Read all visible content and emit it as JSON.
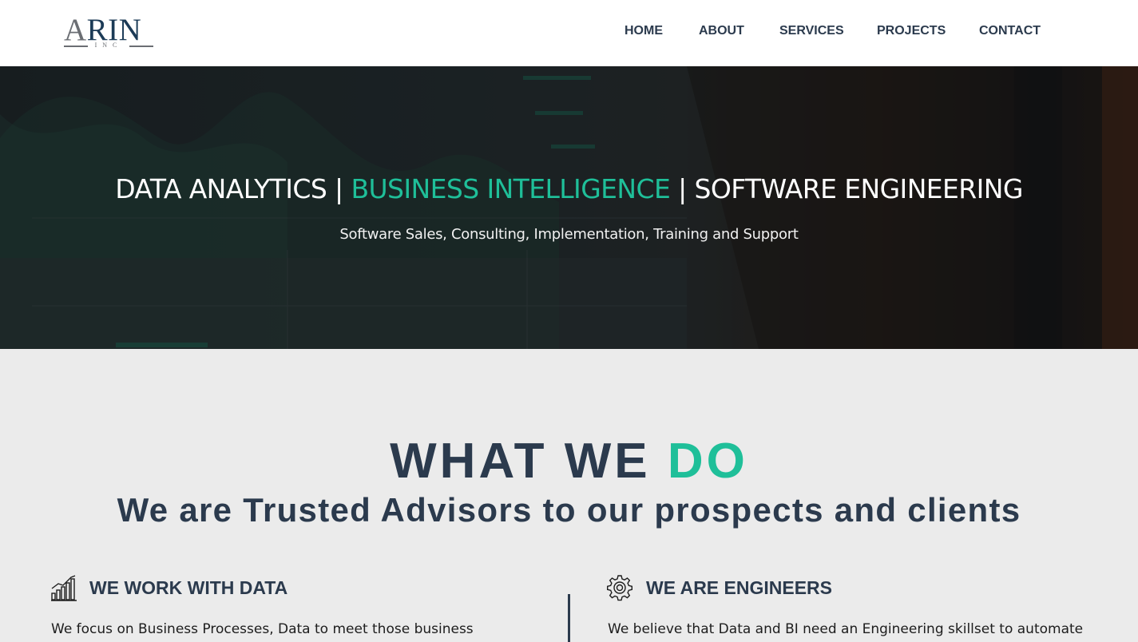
{
  "brand": {
    "logo_first": "A",
    "logo_rest": "RIN",
    "logo_sub": "INC"
  },
  "nav": {
    "items": [
      {
        "label": "HOME"
      },
      {
        "label": "ABOUT"
      },
      {
        "label": "SERVICES"
      },
      {
        "label": "PROJECTS"
      },
      {
        "label": "CONTACT"
      }
    ]
  },
  "hero": {
    "title_part1": "DATA ANALYTICS | ",
    "title_accent": "BUSINESS INTELLIGENCE",
    "title_part3": " | SOFTWARE ENGINEERING",
    "subtitle": "Software Sales, Consulting, Implementation, Training and Support"
  },
  "what_we_do": {
    "title_main": "WHAT WE ",
    "title_accent": "DO",
    "subtitle": "We are Trusted Advisors to our prospects and clients",
    "columns": [
      {
        "icon": "bar-chart-growth-icon",
        "heading": "WE WORK WITH DATA",
        "text": "We focus on Business Processes, Data to meet those business"
      },
      {
        "icon": "gear-icon",
        "heading": "WE ARE ENGINEERS",
        "text": "We believe that Data and BI need an Engineering skillset to automate"
      }
    ]
  },
  "colors": {
    "navy": "#2b3a4d",
    "accent_green": "#1fbf99",
    "section_bg": "#ebebeb"
  }
}
